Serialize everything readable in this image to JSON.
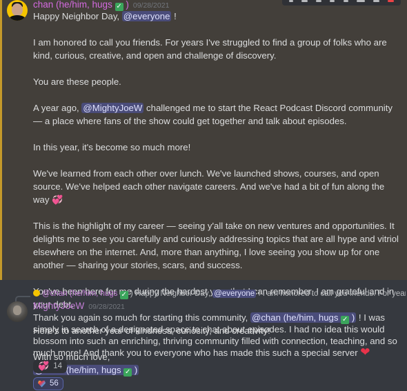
{
  "message1": {
    "author": "chan (he/him, hugs",
    "author_suffix": ")",
    "timestamp": "09/28/2021",
    "greeting_prefix": "Happy Neighbor Day,",
    "greeting_mention": "@everyone",
    "greeting_suffix": "!",
    "p1": "I am honored to call you friends. For years I've struggled to find a group of folks who are kind, curious, creative, and open and challenge of discovery.",
    "p2": "You are these people.",
    "p3_prefix": "A year ago,",
    "p3_mention": "@MightyJoeW",
    "p3_suffix": "challenged me to start the React Podcast Discord community — a place where fans of the show could get together and talk about episodes.",
    "p4": "In this year, it's become so much more!",
    "p5": "We've learned from each other over lunch. We've launched shows, courses, and open source. We've helped each other navigate careers. And we've had a bit of fun along the way",
    "p6": "This is the highlight of my career —  seeing y'all take on new ventures and opportunities. It delights me to see you carefully and curiously addressing topics that are all hype and vitriol elsewhere on the internet. And, more than anything, I love seeing you show up for one another — sharing your stories, scars, and success.",
    "p7": "You've been here for me during the hardest year that I can remember. I am grateful and in your debt.",
    "p8": "Here's to another year of kindness, curiosity, and creativity!",
    "p9": "With so much love,",
    "signature_mention": "@chan (he/him, hugs",
    "signature_suffix": ")",
    "reaction": {
      "icon": "rainbow-heart",
      "count": "56"
    }
  },
  "reply_preview": {
    "mention": "@chan (he/him, hugs",
    "suffix": ") Happy Neighbor Day,",
    "everyone": "@everyone",
    "rest": "! I am honored to call you friends. For years I've struggled to fi..."
  },
  "message2": {
    "author": "MightyJoeW",
    "timestamp": "09/28/2021",
    "text_prefix": "Thank you again so much for starting this community,",
    "mention": "@chan (he/him, hugs",
    "mention_suffix": ")",
    "text_suffix": "! I was simply in search of a designated space to chat about episodes. I had no idea this would blossom into such an enriching, thriving community filled with connection, teaching, and so much more! And thank you to everyone who has made this such a special server",
    "reaction": {
      "icon": "heart-ribbon",
      "count": "14"
    }
  },
  "check_glyph": "✓",
  "heart_glyph": "❤",
  "two_hearts_glyph": "💞"
}
